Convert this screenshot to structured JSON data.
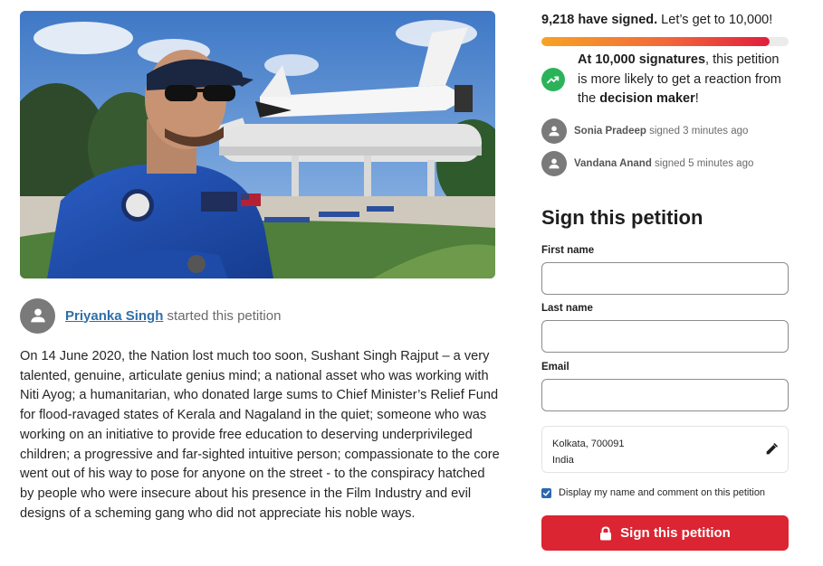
{
  "hero": {
    "image_subject": "photo-man-in-blue-flight-suit-with-space-shuttle"
  },
  "starter": {
    "name": "Priyanka Singh",
    "suffix": " started this petition"
  },
  "body_text": "On 14 June 2020, the Nation lost much too soon, Sushant Singh Rajput – a very talented, genuine, articulate genius mind; a national asset who was working with Niti Ayog; a humanitarian, who donated large sums to Chief Minister’s Relief Fund for flood-ravaged states of Kerala and Nagaland in the quiet; someone who was working on an initiative to provide free education to deserving underprivileged children; a progressive and far-sighted intuitive person; compassionate to the core went out of his way to pose for anyone on the street - to the conspiracy hatched by people who were insecure about his presence in the Film Industry and evil designs of a scheming gang who did not appreciate his noble ways.",
  "signatures": {
    "count_text": "9,218 have signed.",
    "goal_text": " Let’s get to 10,000!",
    "progress": 0.9218,
    "colors": {
      "start": "#f7a325",
      "end": "#e01f3d"
    }
  },
  "goal_message": {
    "bold1": "At 10,000 signatures",
    "mid": ", this petition is more likely to get a reaction from the ",
    "bold2": "decision maker",
    "end": "!",
    "icon": "trending-up-icon",
    "icon_color": "#2cb35a"
  },
  "recent_signers": [
    {
      "name": "Sonia Pradeep",
      "action": " signed 3 minutes ago"
    },
    {
      "name": "Vandana Anand",
      "action": " signed 5 minutes ago"
    }
  ],
  "form": {
    "title": "Sign this petition",
    "first_name_label": "First name",
    "first_name_value": "",
    "last_name_label": "Last name",
    "last_name_value": "",
    "email_label": "Email",
    "email_value": "",
    "location_line1": "Kolkata, 700091",
    "location_line2": "India",
    "display_checkbox_checked": true,
    "display_label": "Display my name and comment on this petition",
    "submit_label": "Sign this petition",
    "submit_color": "#dc2532"
  }
}
